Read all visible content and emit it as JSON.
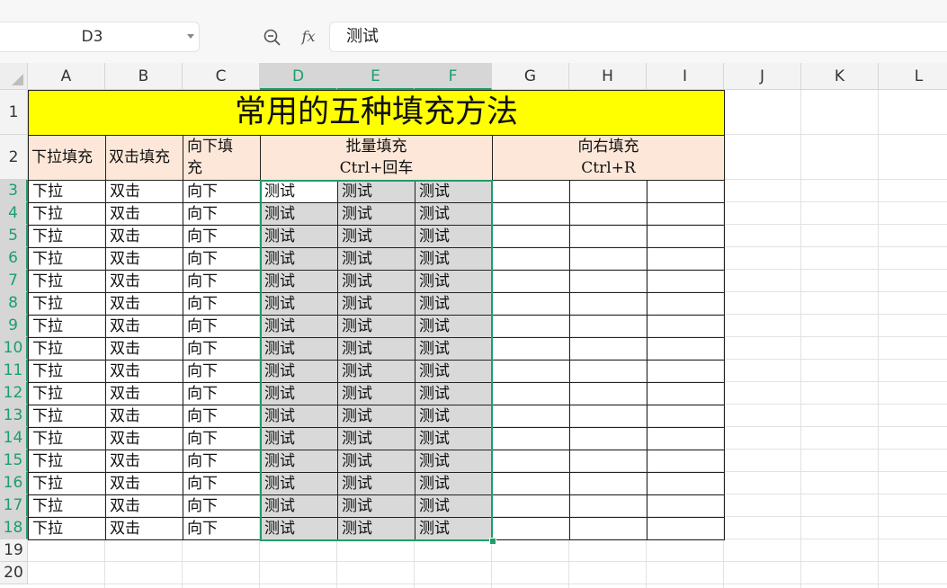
{
  "formula_bar": {
    "name_box": "D3",
    "fx_label": "fx",
    "formula_value": "测试"
  },
  "columns": [
    "A",
    "B",
    "C",
    "D",
    "E",
    "F",
    "G",
    "H",
    "I",
    "J",
    "K",
    "L"
  ],
  "rows": [
    "1",
    "2",
    "3",
    "4",
    "5",
    "6",
    "7",
    "8",
    "9",
    "10",
    "11",
    "12",
    "13",
    "14",
    "15",
    "16",
    "17",
    "18",
    "19",
    "20"
  ],
  "selected_columns": [
    "D",
    "E",
    "F"
  ],
  "selected_rows_from": 3,
  "selected_rows_to": 18,
  "sheet": {
    "title": "常用的五种填充方法",
    "headers": {
      "a": "下拉填充",
      "b": "双击填充",
      "c_line1": "向下填",
      "c_line2": "充",
      "def_line1": "批量填充",
      "def_line2": "Ctrl+回车",
      "ghi_line1": "向右填充",
      "ghi_line2": "Ctrl+R"
    },
    "col_a_value": "下拉",
    "col_b_value": "双击",
    "col_c_value": "向下",
    "col_def_value": "测试",
    "data_row_count": 16
  },
  "colors": {
    "title_fill": "#ffff00",
    "header_fill": "#fde7d8",
    "selection_border": "#1f9d6b",
    "selected_fill": "#d9d9d9"
  }
}
